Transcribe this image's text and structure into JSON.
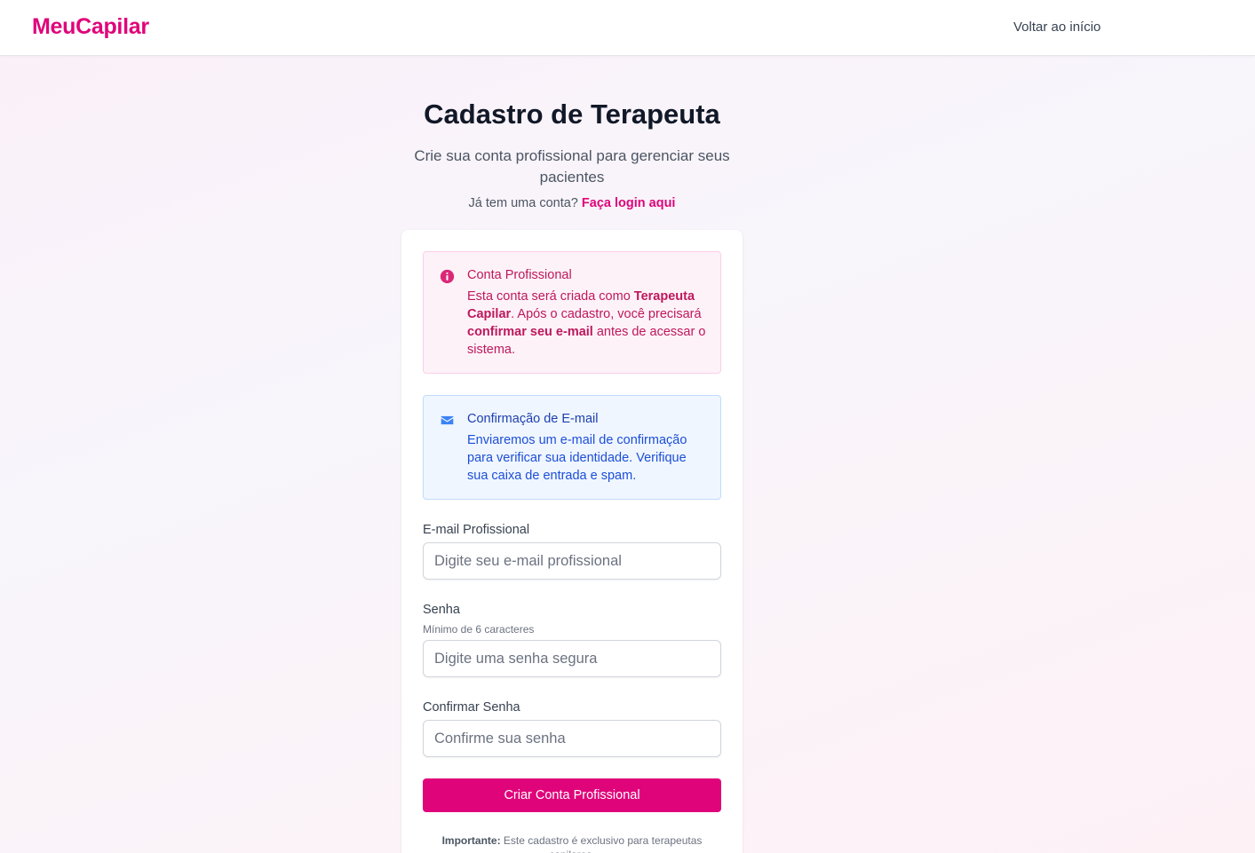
{
  "header": {
    "brand": "MeuCapilar",
    "back_link": "Voltar ao início"
  },
  "intro": {
    "title": "Cadastro de Terapeuta",
    "subtitle": "Crie sua conta profissional para gerenciar seus pacientes",
    "login_prompt": "Já tem uma conta?",
    "login_link": "Faça login aqui"
  },
  "notices": {
    "professional": {
      "icon": "info-icon",
      "title": "Conta Profissional",
      "text_1": "Esta conta será criada como ",
      "bold_1": "Terapeuta Capilar",
      "text_2": ". Após o cadastro, você precisará ",
      "bold_2": "confirmar seu e-mail",
      "text_3": " antes de acessar o sistema."
    },
    "email": {
      "icon": "envelope-icon",
      "title": "Confirmação de E-mail",
      "text": "Enviaremos um e-mail de confirmação para verificar sua identidade. Verifique sua caixa de entrada e spam."
    }
  },
  "form": {
    "email": {
      "label": "E-mail Profissional",
      "placeholder": "Digite seu e-mail profissional",
      "value": ""
    },
    "password": {
      "label": "Senha",
      "hint": "Mínimo de 6 caracteres",
      "placeholder": "Digite uma senha segura",
      "value": ""
    },
    "confirm_password": {
      "label": "Confirmar Senha",
      "placeholder": "Confirme sua senha",
      "value": ""
    },
    "submit_label": "Criar Conta Profissional"
  },
  "footer_note": {
    "bold": "Importante:",
    "text": " Este cadastro é exclusivo para terapeutas capilares."
  },
  "colors": {
    "brand": "#e0047a",
    "pro_notice_bg": "#fdf2f8",
    "mail_notice_bg": "#eff6ff"
  }
}
